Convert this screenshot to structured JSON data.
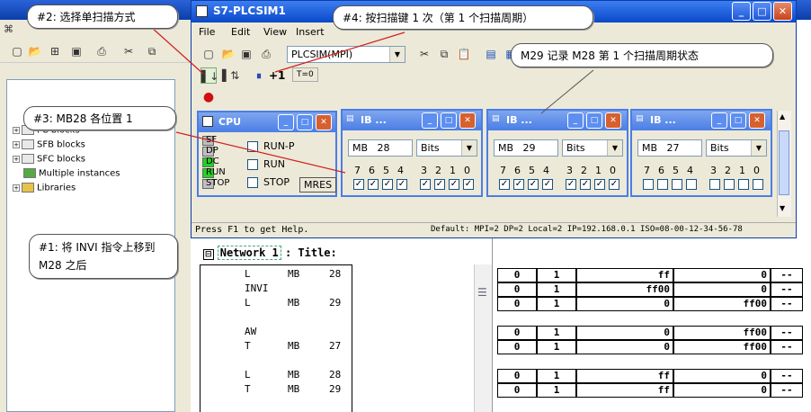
{
  "step7": {
    "title_icon": "simatic-icon",
    "menu": [
      "File",
      "Edit",
      "View",
      "Insert"
    ],
    "tree": [
      "FC blocks",
      "SFB blocks",
      "SFC blocks",
      "Multiple instances",
      "Libraries"
    ],
    "network_label": "Network 1",
    "network_title": ": Title:",
    "code": [
      {
        "op": "L",
        "area": "MB",
        "addr": "28"
      },
      {
        "op": "INVI",
        "area": "",
        "addr": ""
      },
      {
        "op": "L",
        "area": "MB",
        "addr": "29"
      },
      {
        "op": "",
        "area": "",
        "addr": ""
      },
      {
        "op": "AW",
        "area": "",
        "addr": ""
      },
      {
        "op": "T",
        "area": "MB",
        "addr": "27"
      },
      {
        "op": "",
        "area": "",
        "addr": ""
      },
      {
        "op": "L",
        "area": "MB",
        "addr": "28"
      },
      {
        "op": "T",
        "area": "MB",
        "addr": "29"
      }
    ],
    "table_rows": [
      [
        "0",
        "1",
        "ff",
        "0",
        "--"
      ],
      [
        "0",
        "1",
        "ff00",
        "0",
        "--"
      ],
      [
        "0",
        "1",
        "0",
        "ff00",
        "--"
      ],
      [
        "",
        "",
        "",
        "",
        ""
      ],
      [
        "0",
        "1",
        "0",
        "ff00",
        "--"
      ],
      [
        "0",
        "1",
        "0",
        "ff00",
        "--"
      ],
      [
        "",
        "",
        "",
        "",
        ""
      ],
      [
        "0",
        "1",
        "ff",
        "0",
        "--"
      ],
      [
        "0",
        "1",
        "ff",
        "0",
        "--"
      ]
    ],
    "right_col_marker": "1"
  },
  "plcsim": {
    "title": "S7-PLCSIM1",
    "menu": [
      "File",
      "Edit",
      "View",
      "Insert"
    ],
    "toolbar_combo": "PLCSIM(MPI)",
    "scan_ops": {
      "single_label": "+1",
      "timer_label": "T=0"
    },
    "cpu": {
      "title": "CPU",
      "leds": [
        "SF",
        "DP",
        "DC",
        "RUN",
        "STOP"
      ],
      "modes": [
        "RUN-P",
        "RUN",
        "STOP"
      ],
      "mres": "MRES"
    },
    "mb_windows": [
      {
        "title": "IB ...",
        "addr": "28",
        "format": "Bits",
        "bits": [
          "7",
          "6",
          "5",
          "4",
          "3",
          "2",
          "1",
          "0"
        ],
        "checked": [
          true,
          true,
          true,
          true,
          true,
          true,
          true,
          true
        ]
      },
      {
        "title": "IB ...",
        "addr": "29",
        "format": "Bits",
        "bits": [
          "7",
          "6",
          "5",
          "4",
          "3",
          "2",
          "1",
          "0"
        ],
        "checked": [
          true,
          true,
          true,
          true,
          true,
          true,
          true,
          true
        ]
      },
      {
        "title": "IB ...",
        "addr": "27",
        "format": "Bits",
        "bits": [
          "7",
          "6",
          "5",
          "4",
          "3",
          "2",
          "1",
          "0"
        ],
        "checked": [
          false,
          false,
          false,
          false,
          false,
          false,
          false,
          false
        ]
      }
    ],
    "mb_label": "MB",
    "status_help": "Press F1 to get Help.",
    "status_conn": "Default:  MPI=2 DP=2 Local=2 IP=192.168.0.1 ISO=08-00-12-34-56-78"
  },
  "callouts": {
    "c1": "#1: 将 INVI 指令上移到 M28 之后",
    "c2": "#2: 选择单扫描方式",
    "c3": "#3: MB28 各位置 1",
    "c4": "#4: 按扫描键 1 次（第 1 个扫描周期）",
    "c5": "M29 记录 M28 第 1 个扫描周期状态"
  },
  "colors": {
    "title_blue": "#0a48c8",
    "sub_blue": "#4a7ee6",
    "led_green": "#1fd31f",
    "led_gray": "#bfbfbf"
  }
}
